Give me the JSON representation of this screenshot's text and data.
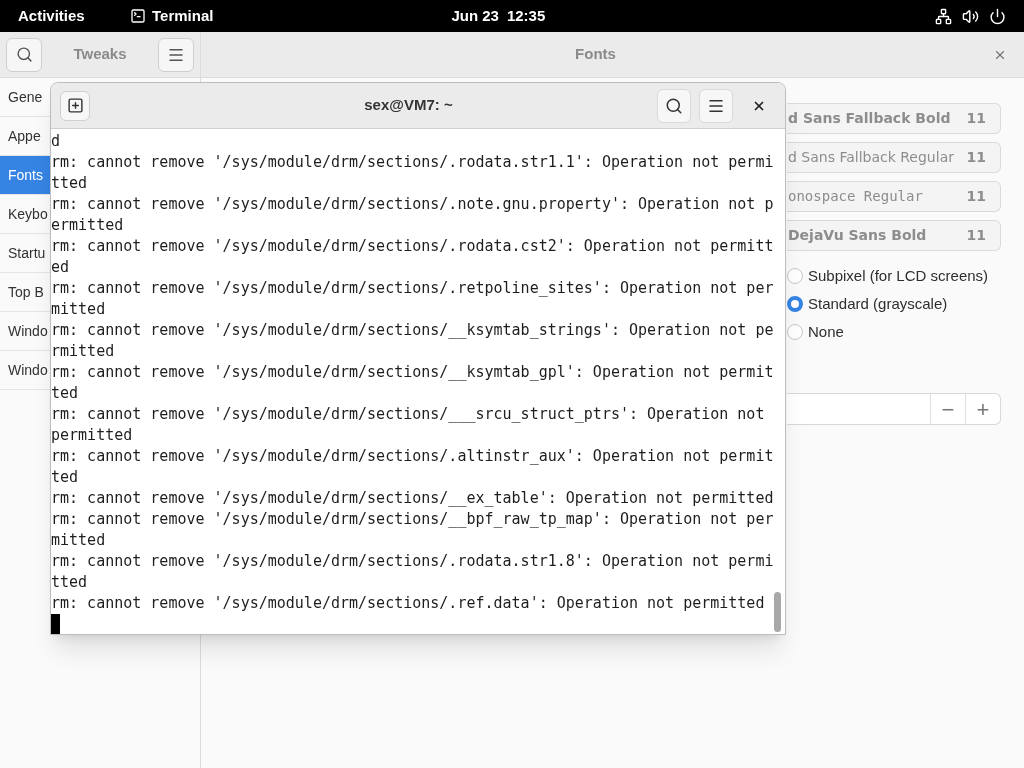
{
  "top_bar": {
    "activities": "Activities",
    "app": "Terminal",
    "date": "Jun 23",
    "time": "12:35"
  },
  "tweaks": {
    "title": "Tweaks",
    "page_title": "Fonts",
    "sidebar": [
      {
        "label": "Gene",
        "selected": false
      },
      {
        "label": "Appe",
        "selected": false
      },
      {
        "label": "Fonts",
        "selected": true
      },
      {
        "label": "Keybo",
        "selected": false
      },
      {
        "label": "Startu",
        "selected": false
      },
      {
        "label": "Top B",
        "selected": false
      },
      {
        "label": "Windo",
        "selected": false
      },
      {
        "label": "Windo",
        "selected": false
      }
    ],
    "font_rows": [
      {
        "name": "d Sans Fallback Bold",
        "size": "11",
        "kind": "bold"
      },
      {
        "name": "d Sans Fallback Regular",
        "size": "11",
        "kind": "regular"
      },
      {
        "name": "onospace Regular",
        "size": "11",
        "kind": "mono"
      },
      {
        "name": "DejaVu Sans Bold",
        "size": "11",
        "kind": "bold"
      }
    ],
    "antialiasing": [
      {
        "label": "Subpixel (for LCD screens)",
        "selected": false
      },
      {
        "label": "Standard (grayscale)",
        "selected": true
      },
      {
        "label": "None",
        "selected": false
      }
    ],
    "scale_buttons": [
      "−",
      "+"
    ]
  },
  "terminal": {
    "title": "sex@VM7: ~",
    "lines": [
      "d",
      "rm: cannot remove '/sys/module/drm/sections/.rodata.str1.1': Operation not permi",
      "tted",
      "rm: cannot remove '/sys/module/drm/sections/.note.gnu.property': Operation not p",
      "ermitted",
      "rm: cannot remove '/sys/module/drm/sections/.rodata.cst2': Operation not permitt",
      "ed",
      "rm: cannot remove '/sys/module/drm/sections/.retpoline_sites': Operation not per",
      "mitted",
      "rm: cannot remove '/sys/module/drm/sections/__ksymtab_strings': Operation not pe",
      "rmitted",
      "rm: cannot remove '/sys/module/drm/sections/__ksymtab_gpl': Operation not permit",
      "ted",
      "rm: cannot remove '/sys/module/drm/sections/___srcu_struct_ptrs': Operation not",
      "permitted",
      "rm: cannot remove '/sys/module/drm/sections/.altinstr_aux': Operation not permit",
      "ted",
      "rm: cannot remove '/sys/module/drm/sections/__ex_table': Operation not permitted",
      "rm: cannot remove '/sys/module/drm/sections/__bpf_raw_tp_map': Operation not per",
      "mitted",
      "rm: cannot remove '/sys/module/drm/sections/.rodata.str1.8': Operation not permi",
      "tted",
      "rm: cannot remove '/sys/module/drm/sections/.ref.data': Operation not permitted"
    ]
  }
}
